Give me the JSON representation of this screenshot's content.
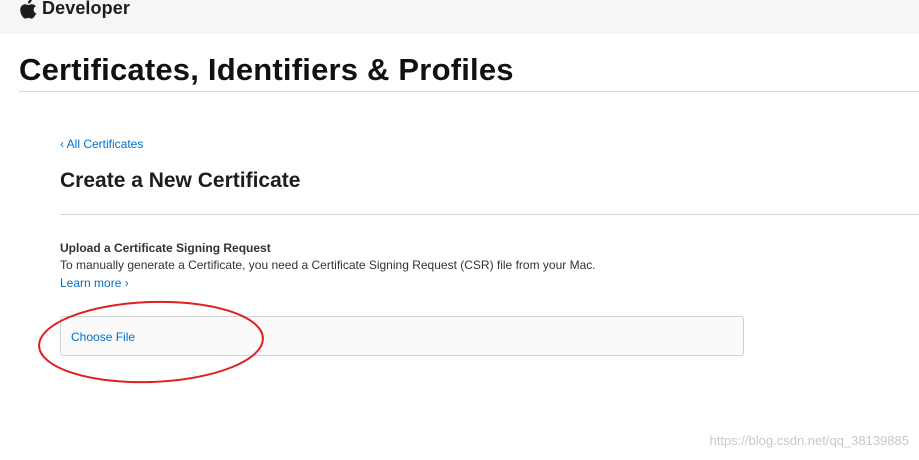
{
  "header": {
    "brand_icon": "apple-logo-icon",
    "brand": "Developer"
  },
  "page": {
    "title": "Certificates, Identifiers & Profiles"
  },
  "content": {
    "back_link": "‹ All Certificates",
    "section_title": "Create a New Certificate",
    "upload_heading": "Upload a Certificate Signing Request",
    "upload_description": "To manually generate a Certificate, you need a Certificate Signing Request (CSR) file from your Mac.",
    "learn_more": "Learn more ›",
    "choose_file": "Choose File"
  },
  "annotation": {
    "shape": "ellipse",
    "color": "#e02020"
  },
  "watermark": "https://blog.csdn.net/qq_38139885",
  "colors": {
    "link": "#0070c9",
    "topbar_bg": "#f6f6f6",
    "text": "#1d1d1f"
  }
}
